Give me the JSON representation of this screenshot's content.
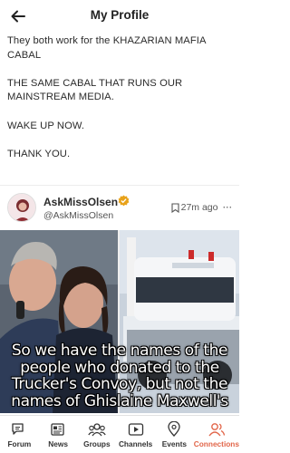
{
  "header": {
    "title": "My Profile",
    "back_icon": "arrow-left-icon"
  },
  "post": {
    "paragraphs": [
      "They both work for the KHAZARIAN MAFIA CABAL",
      "THE SAME CABAL THAT RUNS OUR MAINSTREAM MEDIA.",
      "WAKE UP NOW.",
      "THANK YOU."
    ],
    "author": {
      "name": "AskMissOlsen",
      "handle": "@AskMissOlsen",
      "badge_icon": "verified-badge-icon",
      "badge_color": "#e8a21a"
    },
    "timestamp": "27m ago",
    "bookmark_icon": "bookmark-icon",
    "more_icon": "more-dots-icon",
    "image": {
      "caption_lines": [
        "So we have the names of the",
        "people who donated to the",
        "Trucker's Convoy, but not the",
        "names of Ghislaine Maxwell's"
      ]
    }
  },
  "bottom_nav": {
    "items": [
      {
        "label": "Forum",
        "icon": "forum-icon"
      },
      {
        "label": "News",
        "icon": "news-icon"
      },
      {
        "label": "Groups",
        "icon": "groups-icon"
      },
      {
        "label": "Channels",
        "icon": "channels-icon"
      },
      {
        "label": "Events",
        "icon": "location-pin-icon"
      },
      {
        "label": "Connections",
        "icon": "connections-icon"
      }
    ],
    "active": "Connections",
    "active_color": "#e2664a"
  }
}
